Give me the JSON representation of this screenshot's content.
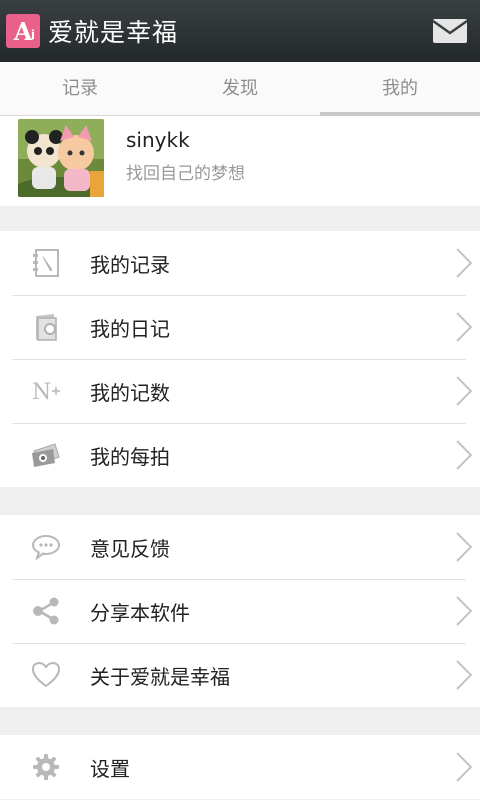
{
  "app": {
    "title": "爱就是幸福",
    "logo_letter": "A",
    "logo_sub": "i",
    "accent": "#e9608a"
  },
  "tabs": [
    {
      "label": "记录",
      "active": false
    },
    {
      "label": "发现",
      "active": false
    },
    {
      "label": "我的",
      "active": true
    }
  ],
  "profile": {
    "username": "sinykk",
    "motto": "找回自己的梦想"
  },
  "menu": {
    "group1": [
      {
        "label": "我的记录",
        "icon": "notebook-icon"
      },
      {
        "label": "我的日记",
        "icon": "diary-icon"
      },
      {
        "label": "我的记数",
        "icon": "counter-icon"
      },
      {
        "label": "我的每拍",
        "icon": "photo-icon"
      }
    ],
    "group2": [
      {
        "label": "意见反馈",
        "icon": "feedback-icon"
      },
      {
        "label": "分享本软件",
        "icon": "share-icon"
      },
      {
        "label": "关于爱就是幸福",
        "icon": "heart-icon"
      }
    ],
    "group3": [
      {
        "label": "设置",
        "icon": "gear-icon"
      }
    ]
  }
}
